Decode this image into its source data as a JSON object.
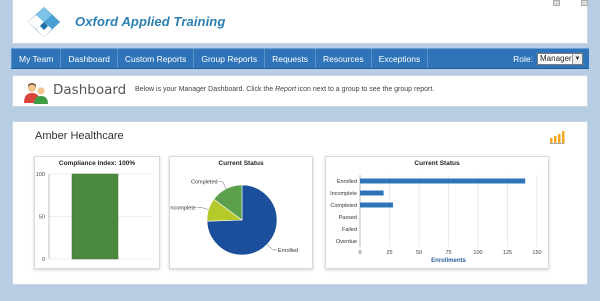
{
  "app": {
    "brand_name": "Oxford Applied Training",
    "accent_color": "#2f74b8"
  },
  "nav": {
    "items": [
      "My Team",
      "Dashboard",
      "Custom Reports",
      "Group Reports",
      "Requests",
      "Resources",
      "Exceptions"
    ],
    "role_label": "Role:",
    "role_value": "Manager"
  },
  "dashboard": {
    "title": "Dashboard",
    "desc_before": "Below is your Manager Dashboard. Click the ",
    "desc_italic": "Report",
    "desc_after": " icon next to a group to see the group report."
  },
  "group": {
    "name": "Amber Healthcare"
  },
  "chart_data": [
    {
      "type": "bar",
      "title": "Compliance Index: 100%",
      "categories": [
        ""
      ],
      "values": [
        100
      ],
      "yticks": [
        0,
        50,
        100
      ],
      "ylim": [
        0,
        100
      ],
      "color": "#4b8a3e"
    },
    {
      "type": "pie",
      "title": "Current Status",
      "labels": [
        "Enrolled",
        "Incomplete",
        "Completed"
      ],
      "values": [
        140,
        20,
        28
      ],
      "colors": [
        "#1b4f9c",
        "#b5c92a",
        "#5ba04c"
      ]
    },
    {
      "type": "bar",
      "orientation": "horizontal",
      "title": "Current Status",
      "categories": [
        "Enrolled",
        "Incomplete",
        "Completed",
        "Passed",
        "Failed",
        "Overdue"
      ],
      "values": [
        140,
        20,
        28,
        0,
        0,
        0
      ],
      "xticks": [
        0,
        25,
        50,
        75,
        100,
        125,
        150
      ],
      "xlim": [
        0,
        150
      ],
      "xlabel": "Enrollments",
      "color": "#2f74b8"
    }
  ]
}
